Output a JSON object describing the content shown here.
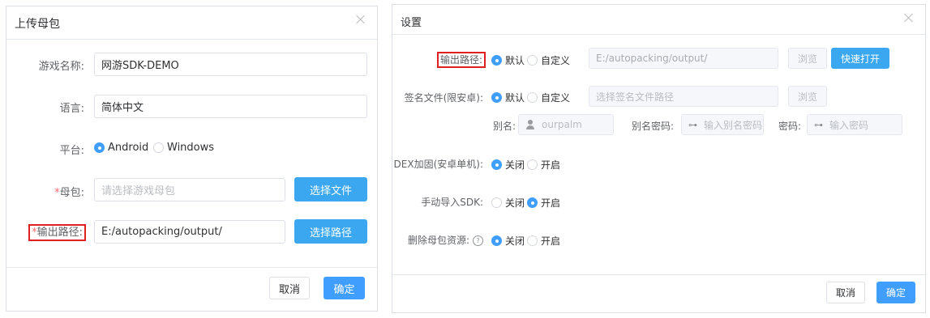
{
  "upload_dialog": {
    "title": "上传母包",
    "game_name": {
      "label": "游戏名称:",
      "value": "网游SDK-DEMO"
    },
    "language": {
      "label": "语言:",
      "value": "简体中文"
    },
    "platform": {
      "label": "平台:",
      "options": [
        "Android",
        "Windows"
      ],
      "selected": "Android"
    },
    "package": {
      "required": "*",
      "label": "母包:",
      "placeholder": "请选择游戏母包",
      "button": "选择文件"
    },
    "output": {
      "required": "*",
      "label": "输出路径:",
      "value": "E:/autopacking/output/",
      "button": "选择路径"
    },
    "footer": {
      "cancel": "取消",
      "ok": "确定"
    }
  },
  "settings_dialog": {
    "title": "设置",
    "output": {
      "label": "输出路径:",
      "options": [
        "默认",
        "自定义"
      ],
      "selected": "默认",
      "path": "E:/autopacking/output/",
      "browse": "浏览",
      "quick_open": "快速打开"
    },
    "sign": {
      "label": "签名文件(限安卓):",
      "options": [
        "默认",
        "自定义"
      ],
      "selected": "默认",
      "placeholder": "选择签名文件路径",
      "browse": "浏览",
      "alias_label": "别名:",
      "alias_value": "ourpalm",
      "alias_pwd_label": "别名密码:",
      "alias_pwd_placeholder": "输入别名密码",
      "pwd_label": "密码:",
      "pwd_placeholder": "输入密码"
    },
    "dex": {
      "label": "DEX加固(安卓单机):",
      "options": [
        "关闭",
        "开启"
      ],
      "selected": "关闭"
    },
    "manual_sdk": {
      "label": "手动导入SDK:",
      "options": [
        "关闭",
        "开启"
      ],
      "selected": "开启"
    },
    "delete_res": {
      "label": "删除母包资源:",
      "help": "?",
      "options": [
        "关闭",
        "开启"
      ],
      "selected": "关闭"
    },
    "footer": {
      "cancel": "取消",
      "ok": "确定"
    }
  }
}
